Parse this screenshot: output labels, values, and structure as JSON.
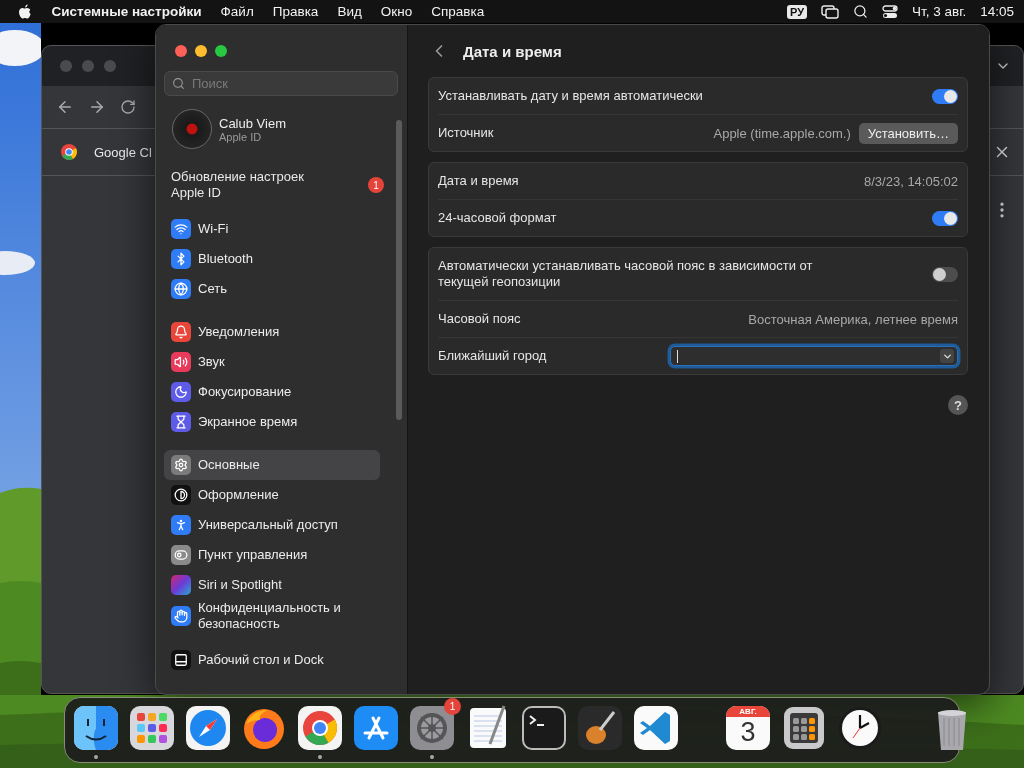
{
  "menu_bar": {
    "app": "Системные настройки",
    "menus": [
      "Файл",
      "Правка",
      "Вид",
      "Окно",
      "Справка"
    ],
    "input_source": "РУ",
    "date": "Чт, 3 авг.",
    "time": "14:05"
  },
  "browser_window": {
    "tab_title": "Google Cl"
  },
  "settings": {
    "search": {
      "placeholder": "Поиск"
    },
    "account": {
      "name": "Calub Viem",
      "subtitle": "Apple ID"
    },
    "update": {
      "label": "Обновление настроек Apple ID",
      "badge": "1"
    },
    "sidebar_groups": [
      [
        {
          "label": "Wi-Fi",
          "selected": false
        },
        {
          "label": "Bluetooth",
          "selected": false
        },
        {
          "label": "Сеть",
          "selected": false
        }
      ],
      [
        {
          "label": "Уведомления",
          "selected": false
        },
        {
          "label": "Звук",
          "selected": false
        },
        {
          "label": "Фокусирование",
          "selected": false
        },
        {
          "label": "Экранное время",
          "selected": false
        }
      ],
      [
        {
          "label": "Основные",
          "selected": true
        },
        {
          "label": "Оформление",
          "selected": false
        },
        {
          "label": "Универсальный доступ",
          "selected": false
        },
        {
          "label": "Пункт управления",
          "selected": false
        },
        {
          "label": "Siri и Spotlight",
          "selected": false
        },
        {
          "label": "Конфиденциальность и безопасность",
          "selected": false
        }
      ],
      [
        {
          "label": "Рабочий стол и Dock",
          "selected": false
        }
      ]
    ],
    "title": "Дата и время",
    "cards": [
      [
        {
          "kind": "toggle",
          "label": "Устанавливать дату и время автоматически",
          "on": true
        },
        {
          "kind": "source",
          "label": "Источник",
          "value": "Apple (time.apple.com.)",
          "button": "Установить…"
        }
      ],
      [
        {
          "kind": "value",
          "label": "Дата и время",
          "value": "8/3/23, 14:05:02"
        },
        {
          "kind": "toggle",
          "label": "24-часовой формат",
          "on": true
        }
      ],
      [
        {
          "kind": "toggle",
          "label": "Автоматически устанавливать часовой пояс в зависимости от текущей геопозиции",
          "on": false
        },
        {
          "kind": "value",
          "label": "Часовой пояс",
          "value": "Восточная Америка, летнее время"
        },
        {
          "kind": "combo",
          "label": "Ближайший город",
          "focused": true
        }
      ]
    ],
    "help": "?"
  },
  "dock": {
    "sections": [
      [
        {
          "kind": "finder",
          "running": true
        },
        {
          "kind": "launchpad",
          "running": false
        },
        {
          "kind": "safari",
          "running": false
        },
        {
          "kind": "firefox",
          "running": false
        },
        {
          "kind": "chrome",
          "running": true
        },
        {
          "kind": "appstore",
          "running": false
        },
        {
          "kind": "settings",
          "running": true,
          "badge": "1"
        },
        {
          "kind": "textedit",
          "running": false
        },
        {
          "kind": "terminal",
          "running": false
        },
        {
          "kind": "garageband",
          "running": false
        },
        {
          "kind": "vscode",
          "running": false
        }
      ],
      [
        {
          "kind": "calendar",
          "running": false,
          "month": "АВГ.",
          "day": "3"
        },
        {
          "kind": "calculator",
          "running": false
        },
        {
          "kind": "clock",
          "running": false
        }
      ],
      [
        {
          "kind": "trash",
          "running": false
        }
      ]
    ]
  }
}
